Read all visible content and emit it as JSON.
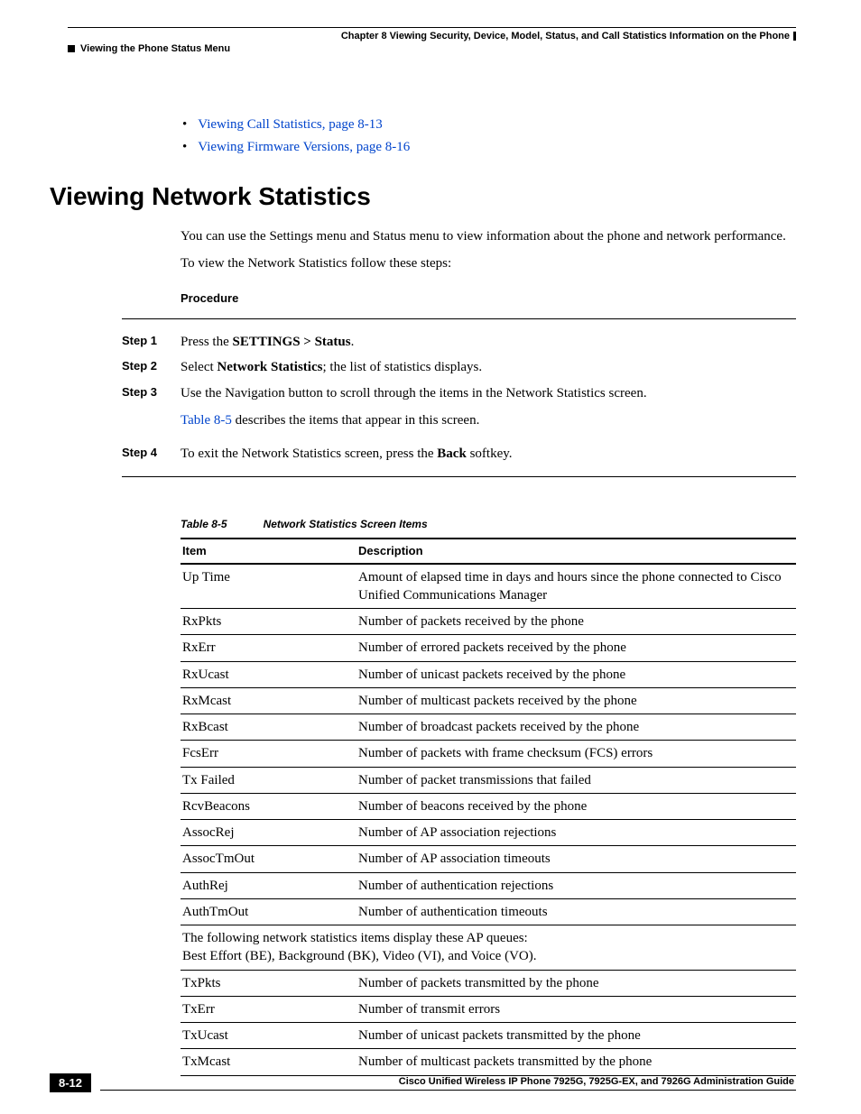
{
  "header": {
    "chapter": "Chapter 8      Viewing Security, Device, Model, Status, and Call Statistics Information on the Phone",
    "section": "Viewing the Phone Status Menu"
  },
  "links": {
    "l1": "Viewing Call Statistics, page 8-13",
    "l2": "Viewing Firmware Versions, page 8-16"
  },
  "heading": "Viewing Network Statistics",
  "intro1": "You can use the Settings menu and Status menu to view information about the phone and network performance.",
  "intro2": "To view the Network Statistics follow these steps:",
  "procedure_label": "Procedure",
  "steps": [
    {
      "label": "Step 1",
      "pre": "Press the ",
      "bold": "SETTINGS > Status",
      "post": "."
    },
    {
      "label": "Step 2",
      "pre": "Select ",
      "bold": "Network Statistics",
      "post": "; the list of statistics displays."
    },
    {
      "label": "Step 3",
      "line1_pre": "Use the Navigation button to scroll through the items in the Network Statistics screen.",
      "line2_link": "Table 8-5",
      "line2_post": " describes the items that appear in this screen."
    },
    {
      "label": "Step 4",
      "pre": "To exit the Network Statistics screen, press the ",
      "bold": "Back",
      "post": " softkey."
    }
  ],
  "table": {
    "number": "Table 8-5",
    "title": "Network Statistics Screen Items",
    "col1": "Item",
    "col2": "Description",
    "rows": [
      {
        "item": "Up Time",
        "desc": "Amount of elapsed time in days and hours since the phone connected to Cisco Unified Communications Manager"
      },
      {
        "item": "RxPkts",
        "desc": "Number of packets received by the phone"
      },
      {
        "item": "RxErr",
        "desc": "Number of errored packets received by the phone"
      },
      {
        "item": "RxUcast",
        "desc": "Number of unicast packets received by the phone"
      },
      {
        "item": "RxMcast",
        "desc": "Number of multicast packets received by the phone"
      },
      {
        "item": "RxBcast",
        "desc": "Number of broadcast packets received by the phone"
      },
      {
        "item": "FcsErr",
        "desc": "Number of packets with frame checksum (FCS) errors"
      },
      {
        "item": "Tx Failed",
        "desc": "Number of packet transmissions that failed"
      },
      {
        "item": "RcvBeacons",
        "desc": "Number of beacons received by the phone"
      },
      {
        "item": "AssocRej",
        "desc": "Number of AP association rejections"
      },
      {
        "item": "AssocTmOut",
        "desc": "Number of AP association timeouts"
      },
      {
        "item": "AuthRej",
        "desc": "Number of authentication rejections"
      },
      {
        "item": "AuthTmOut",
        "desc": "Number of authentication timeouts"
      }
    ],
    "span_note1": "The following network statistics items display these AP queues:",
    "span_note2": "Best Effort (BE), Background (BK), Video (VI), and Voice (VO).",
    "rows2": [
      {
        "item": "TxPkts",
        "desc": "Number of packets transmitted by the phone"
      },
      {
        "item": "TxErr",
        "desc": "Number of transmit errors"
      },
      {
        "item": "TxUcast",
        "desc": "Number of unicast packets transmitted by the phone"
      },
      {
        "item": "TxMcast",
        "desc": "Number of multicast packets transmitted by the phone"
      }
    ]
  },
  "footer": {
    "doc": "Cisco Unified Wireless IP Phone 7925G, 7925G-EX, and 7926G Administration Guide",
    "page": "8-12"
  }
}
